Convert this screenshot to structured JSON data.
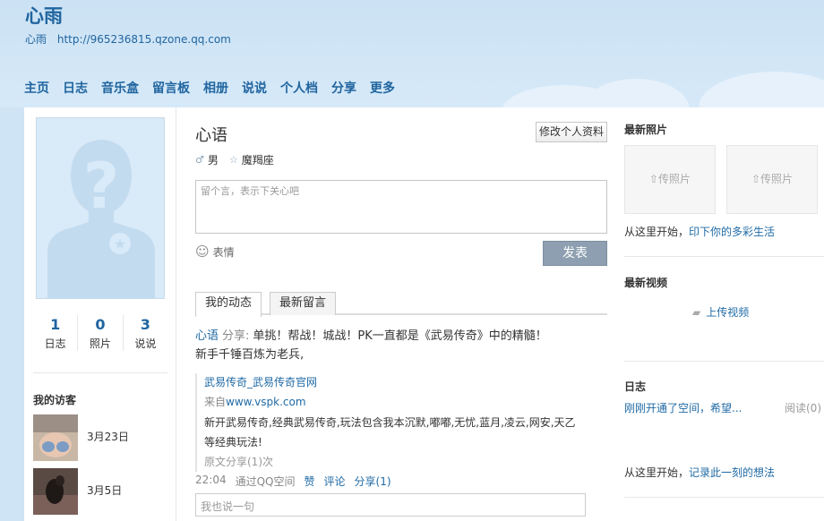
{
  "header": {
    "title": "心雨",
    "owner": "心雨",
    "url": "http://965236815.qzone.qq.com"
  },
  "nav": [
    "主页",
    "日志",
    "音乐盒",
    "留言板",
    "相册",
    "说说",
    "个人档",
    "分享",
    "更多"
  ],
  "left": {
    "stats": [
      {
        "num": "1",
        "label": "日志"
      },
      {
        "num": "0",
        "label": "照片"
      },
      {
        "num": "3",
        "label": "说说"
      }
    ],
    "visitors_title": "我的访客",
    "visitors": [
      {
        "date": "3月23日"
      },
      {
        "date": "3月5日"
      }
    ]
  },
  "main": {
    "mood_title": "心语",
    "edit_label": "修改个人资料",
    "gender": "男",
    "zodiac": "魔羯座",
    "message_placeholder": "留个言，表示下关心吧",
    "emoji_label": "表情",
    "post_label": "发表",
    "tabs": [
      "我的动态",
      "最新留言"
    ],
    "feed": {
      "author": "心语",
      "action": "分享:",
      "text": "单挑！帮战！城战！PK一直都是《武易传奇》中的精髓！",
      "text2": "新手千锤百炼为老兵,",
      "share_title": "武易传奇_武易传奇官网",
      "source_prefix": "来自",
      "source_link": "www.vspk.com",
      "desc": "新开武易传奇,经典武易传奇,玩法包含我本沉默,嘟嘟,无忧,蓝月,凌云,网安,天乙",
      "desc2": "等经典玩法!",
      "orig": "原文分享(1)次",
      "time": "22:04",
      "via": "通过QQ空间",
      "like": "赞",
      "comment": "评论",
      "share": "分享(1)",
      "reply_placeholder": "我也说一句"
    }
  },
  "right": {
    "photos_title": "最新照片",
    "upload_photo": "传照片",
    "photo_tip_prefix": "从这里开始，",
    "photo_tip_link": "印下你的多彩生活",
    "video_title": "最新视频",
    "upload_video": "上传视频",
    "blog_title": "日志",
    "blog_item": "刚刚开通了空间，希望...",
    "blog_read": "阅读(0)",
    "blog_tip_prefix": "从这里开始，",
    "blog_tip_link": "记录此一刻的想法"
  }
}
